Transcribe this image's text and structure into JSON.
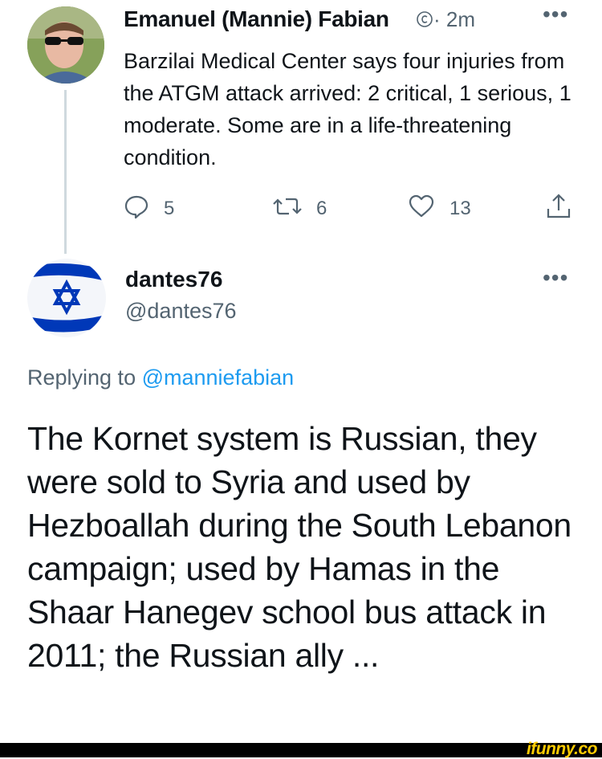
{
  "tweet1": {
    "author": "Emanuel (Mannie) Fabian",
    "meta": "· 2m",
    "more": "•••",
    "text": "Barzilai Medical Center says four injuries from the ATGM attack arrived: 2 critical, 1 serious, 1 moderate. Some are in a life-threatening condition.",
    "replies": "5",
    "retweets": "6",
    "likes": "13"
  },
  "tweet2": {
    "author": "dantes76",
    "handle": "@dantes76",
    "more": "•••",
    "replying_prefix": "Replying to",
    "replying_to": "@manniefabian",
    "text": "The Kornet system is Russian, they were sold to Syria and used by Hezboallah during the South Lebanon campaign; used by Hamas in the Shaar Hanegev school bus attack in 2011; the Russian ally ..."
  },
  "watermark": "ifunny.co",
  "icons": {
    "reply": "reply-icon",
    "retweet": "retweet-icon",
    "like": "heart-icon",
    "share": "share-icon",
    "verified": "verified-icon"
  },
  "colors": {
    "text": "#0f1419",
    "secondary": "#536471",
    "link": "#1d9bf0",
    "flag_blue": "#0038b8",
    "watermark": "#ffcc00"
  }
}
